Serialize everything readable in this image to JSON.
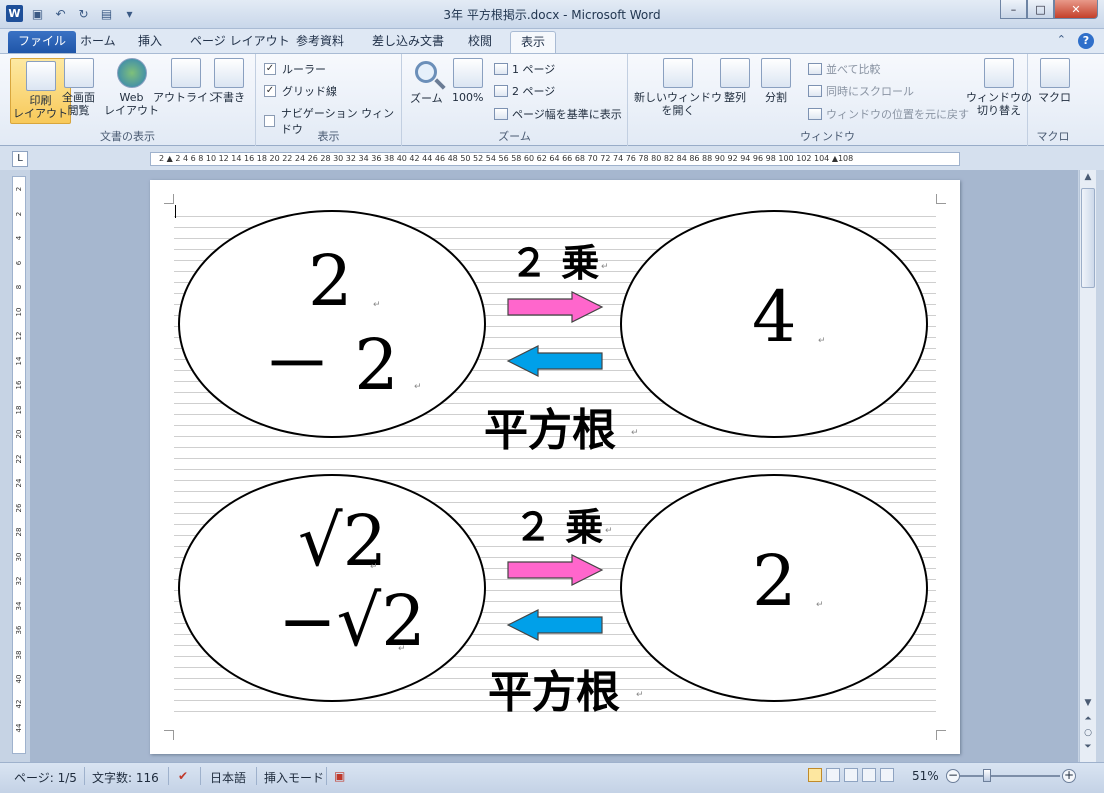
{
  "window": {
    "title": "3年 平方根掲示.docx - Microsoft Word",
    "app_icon": "W",
    "minimize": "–",
    "maximize": "□",
    "close": "✕"
  },
  "tabs": [
    {
      "label": "ファイル"
    },
    {
      "label": "ホーム"
    },
    {
      "label": "挿入"
    },
    {
      "label": "ページ レイアウト"
    },
    {
      "label": "参考資料"
    },
    {
      "label": "差し込み文書"
    },
    {
      "label": "校閲"
    },
    {
      "label": "表示"
    }
  ],
  "ribbon": {
    "doc_views": {
      "label": "文書の表示",
      "print_layout": "印刷\nレイアウト",
      "full_screen": "全画面\n閲覧",
      "web_layout": "Web\nレイアウト",
      "outline": "アウトライン",
      "draft": "下書き"
    },
    "show": {
      "label": "表示",
      "ruler": "ルーラー",
      "gridlines": "グリッド線",
      "nav_pane": "ナビゲーション ウィンドウ"
    },
    "zoom": {
      "label": "ズーム",
      "zoom_btn": "ズーム",
      "hundred": "100%",
      "one_page": "1 ページ",
      "two_pages": "2 ページ",
      "page_width": "ページ幅を基準に表示"
    },
    "window": {
      "label": "ウィンドウ",
      "new_window": "新しいウィンドウ\nを開く",
      "arrange": "整列",
      "split": "分割",
      "side_by_side": "並べて比較",
      "sync_scroll": "同時にスクロール",
      "reset_pos": "ウィンドウの位置を元に戻す",
      "switch": "ウィンドウの\n切り替え"
    },
    "macro": {
      "label": "マクロ",
      "macro_btn": "マクロ"
    }
  },
  "ruler": "2 ▲ 2 4 6 8 10 12 14 16 18 20 22 24 26 28 30 32 34 36 38 40 42 44 46 48 50 52 54 56 58 60 62 64 66 68 70 72 74 76 78 80 82 84 86 88 90 92 94 96 98 100 102 104 ▲108",
  "vruler_ticks": [
    "2",
    "2",
    "4",
    "6",
    "8",
    "10",
    "12",
    "14",
    "16",
    "18",
    "20",
    "22",
    "24",
    "26",
    "28",
    "30",
    "32",
    "34",
    "36",
    "38",
    "40",
    "42",
    "44"
  ],
  "document": {
    "top": {
      "left_line1": "2",
      "left_line2": "－ 2",
      "arrow_label_top": "２ 乗",
      "arrow_label_bottom": "平方根",
      "right": "4"
    },
    "bottom": {
      "left_line1": "√2",
      "left_line2": "−√2",
      "arrow_label_top": "２ 乗",
      "arrow_label_bottom": "平方根",
      "right": "2"
    },
    "colors": {
      "pink_arrow": "#ff66cc",
      "blue_arrow": "#00a0e9"
    },
    "para_mark": "↵"
  },
  "status": {
    "page": "ページ: 1/5",
    "words": "文字数: 116",
    "language": "日本語",
    "mode": "挿入モード",
    "zoom": "51%"
  }
}
